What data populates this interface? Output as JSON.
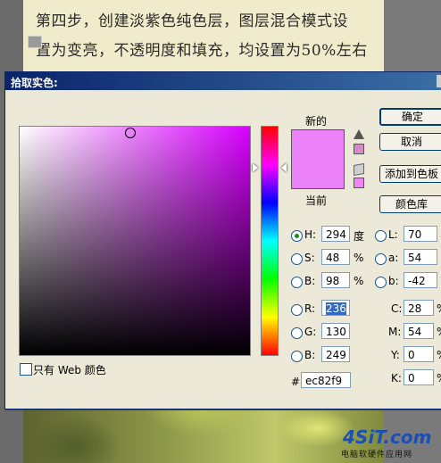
{
  "background_doc": {
    "line1": "第四步，创建淡紫色纯色层，图层混合模式设",
    "line2": "置为变亮，不透明度和填充，均设置为50%左右"
  },
  "dialog": {
    "title": "拾取实色:",
    "new_label": "新的",
    "current_label": "当前",
    "new_color": "#ec82f9",
    "current_color": "#ec82f9",
    "hue_color": "#d800ff",
    "buttons": {
      "ok": "确定",
      "cancel": "取消",
      "add_to_swatches": "添加到色板",
      "color_libraries": "颜色库"
    },
    "hsb": {
      "h_label": "H:",
      "h_value": "294",
      "h_unit": "度",
      "s_label": "S:",
      "s_value": "48",
      "s_unit": "%",
      "b_label": "B:",
      "b_value": "98",
      "b_unit": "%"
    },
    "rgb": {
      "r_label": "R:",
      "r_value": "236",
      "g_label": "G:",
      "g_value": "130",
      "b_label": "B:",
      "b_value": "249"
    },
    "lab": {
      "l_label": "L:",
      "l_value": "70",
      "a_label": "a:",
      "a_value": "54",
      "b_label": "b:",
      "b_value": "-42"
    },
    "cmyk": {
      "c_label": "C:",
      "c_value": "28",
      "c_unit": "%",
      "m_label": "M:",
      "m_value": "54",
      "m_unit": "%",
      "y_label": "Y:",
      "y_value": "0",
      "y_unit": "%",
      "k_label": "K:",
      "k_value": "0",
      "k_unit": "%"
    },
    "hex_label": "#",
    "hex_value": "ec82f9",
    "web_only_label": "只有 Web 颜色",
    "web_only_checked": false
  },
  "watermark": {
    "brand": "4SiT.com",
    "subtitle": "电脑软硬件应用网"
  }
}
